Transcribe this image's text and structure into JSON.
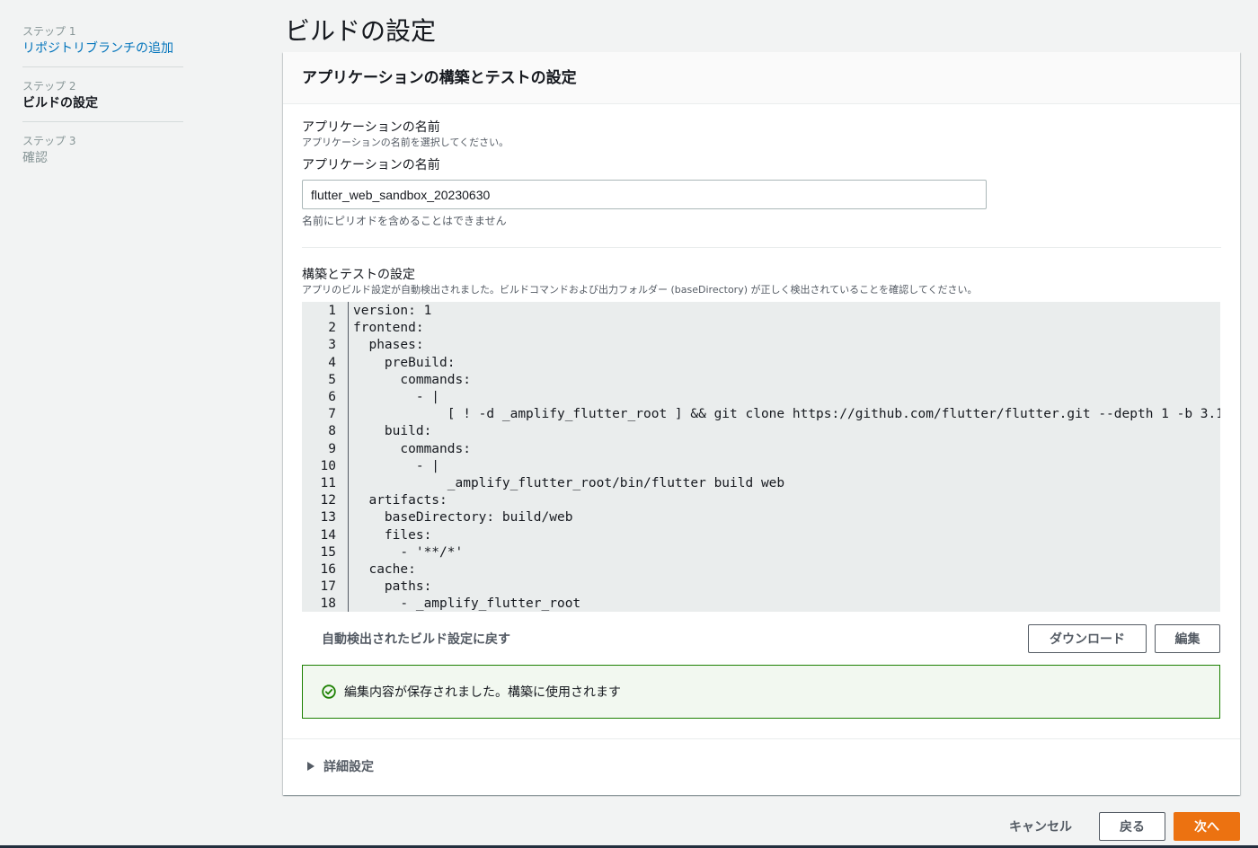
{
  "wizard": {
    "steps": [
      {
        "number": "ステップ 1",
        "title": "リポジトリブランチの追加"
      },
      {
        "number": "ステップ 2",
        "title": "ビルドの設定"
      },
      {
        "number": "ステップ 3",
        "title": "確認"
      }
    ],
    "current_step": 2
  },
  "page": {
    "title": "ビルドの設定"
  },
  "container": {
    "header": "アプリケーションの構築とテストの設定"
  },
  "app_name": {
    "label": "アプリケーションの名前",
    "description": "アプリケーションの名前を選択してください。",
    "field_label": "アプリケーションの名前",
    "value": "flutter_web_sandbox_20230630",
    "constraint": "名前にピリオドを含めることはできません"
  },
  "build_settings": {
    "label": "構築とテストの設定",
    "description": "アプリのビルド設定が自動検出されました。ビルドコマンドおよび出力フォルダー (baseDirectory) が正しく検出されていることを確認してください。",
    "code_lines": [
      "version: 1",
      "frontend:",
      "  phases:",
      "    preBuild:",
      "      commands:",
      "        - |",
      "            [ ! -d _amplify_flutter_root ] && git clone https://github.com/flutter/flutter.git --depth 1 -b 3.1",
      "    build:",
      "      commands:",
      "        - |",
      "            _amplify_flutter_root/bin/flutter build web",
      "  artifacts:",
      "    baseDirectory: build/web",
      "    files:",
      "      - '**/*'",
      "  cache:",
      "    paths:",
      "      - _amplify_flutter_root"
    ],
    "revert_label": "自動検出されたビルド設定に戻す",
    "download_label": "ダウンロード",
    "edit_label": "編集"
  },
  "flash": {
    "message": "編集内容が保存されました。構築に使用されます",
    "color": "#1d8102"
  },
  "advanced": {
    "label": "詳細設定"
  },
  "footer": {
    "cancel_label": "キャンセル",
    "back_label": "戻る",
    "next_label": "次へ"
  },
  "colors": {
    "link": "#0073bb",
    "primary": "#ec7211",
    "success": "#1d8102"
  }
}
